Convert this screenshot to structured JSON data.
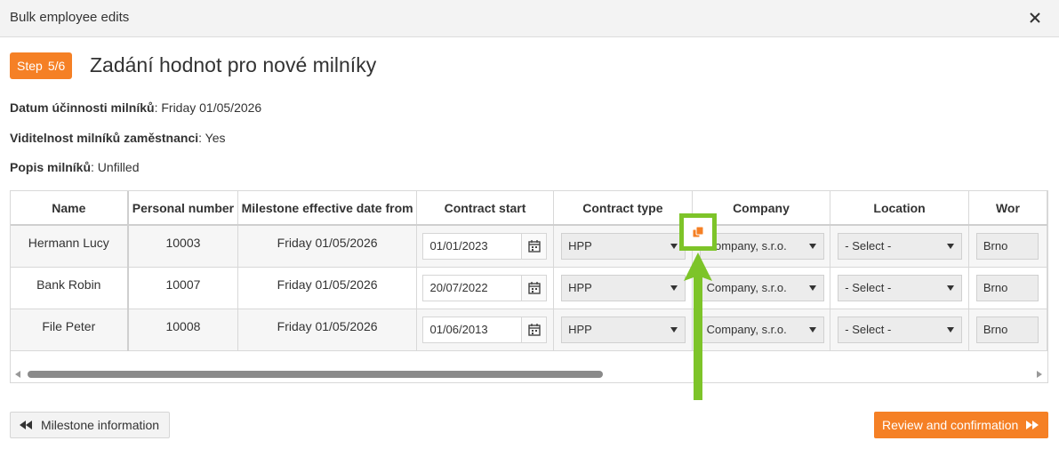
{
  "dialog": {
    "title": "Bulk employee edits",
    "close_icon": "close-icon"
  },
  "step": {
    "label": "Step",
    "value": "5/6"
  },
  "heading": "Zadání hodnot pro nové milníky",
  "info": {
    "effective_date": {
      "label": "Datum účinnosti milníků",
      "value": ": Friday 01/05/2026"
    },
    "visibility": {
      "label": "Viditelnost milníků zaměstnanci",
      "value": ": Yes"
    },
    "description": {
      "label": "Popis milníků",
      "value": ": Unfilled"
    }
  },
  "table": {
    "columns": [
      "Name",
      "Personal number",
      "Milestone effective date from",
      "Contract start",
      "Contract type",
      "Company",
      "Location",
      "Wor"
    ],
    "rows": [
      {
        "name": "Hermann Lucy",
        "personal_number": "10003",
        "effective_date": "Friday 01/05/2026",
        "contract_start": "01/01/2023",
        "contract_type": "HPP",
        "company": "Company, s.r.o.",
        "location": "- Select -",
        "work": "Brno"
      },
      {
        "name": "Bank Robin",
        "personal_number": "10007",
        "effective_date": "Friday 01/05/2026",
        "contract_start": "20/07/2022",
        "contract_type": "HPP",
        "company": "Company, s.r.o.",
        "location": "- Select -",
        "work": "Brno"
      },
      {
        "name": "File Peter",
        "personal_number": "10008",
        "effective_date": "Friday 01/05/2026",
        "contract_start": "01/06/2013",
        "contract_type": "HPP",
        "company": "Company, s.r.o.",
        "location": "- Select -",
        "work": "Brno"
      }
    ]
  },
  "footer": {
    "back_label": "Milestone information",
    "next_label": "Review and confirmation"
  },
  "colors": {
    "accent": "#f58025",
    "highlight": "#7dc429"
  }
}
